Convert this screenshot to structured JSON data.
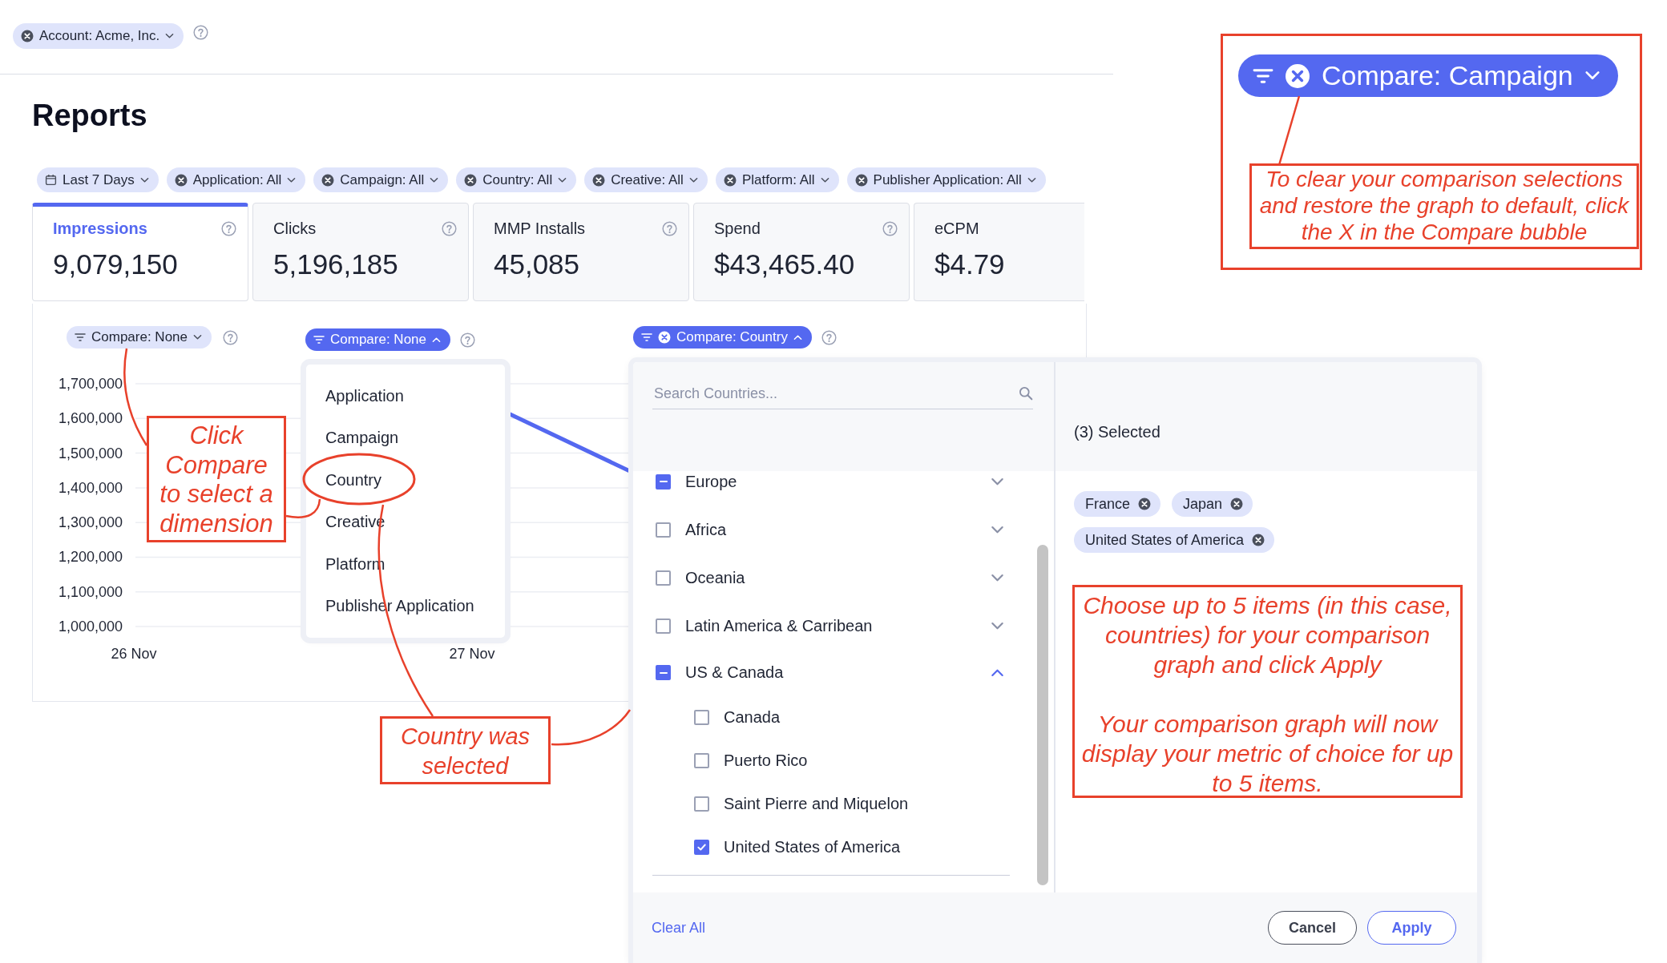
{
  "account_filter": {
    "label": "Account: Acme, Inc."
  },
  "page_title": "Reports",
  "filters": [
    {
      "label": "Last 7 Days",
      "kind": "date"
    },
    {
      "label": "Application: All",
      "kind": "clearable"
    },
    {
      "label": "Campaign: All",
      "kind": "clearable"
    },
    {
      "label": "Country: All",
      "kind": "clearable"
    },
    {
      "label": "Creative: All",
      "kind": "clearable"
    },
    {
      "label": "Platform: All",
      "kind": "clearable"
    },
    {
      "label": "Publisher Application: All",
      "kind": "clearable"
    }
  ],
  "metrics": [
    {
      "label": "Impressions",
      "value": "9,079,150",
      "selected": true,
      "help": true
    },
    {
      "label": "Clicks",
      "value": "5,196,185",
      "selected": false,
      "help": true
    },
    {
      "label": "MMP Installs",
      "value": "45,085",
      "selected": false,
      "help": true
    },
    {
      "label": "Spend",
      "value": "$43,465.40",
      "selected": false,
      "help": true
    },
    {
      "label": "eCPM",
      "value": "$4.79",
      "selected": false,
      "help": false
    }
  ],
  "chart": {
    "compare_chip": {
      "label": "Compare: None",
      "active": false,
      "clearable": false,
      "expanded": false
    },
    "y_axis_labels": [
      "1,700,000",
      "1,600,000",
      "1,500,000",
      "1,400,000",
      "1,300,000",
      "1,200,000",
      "1,100,000",
      "1,000,000"
    ],
    "x_axis_labels": [
      "26 Nov",
      "27 Nov"
    ]
  },
  "compare_menu": {
    "chip": {
      "label": "Compare: None",
      "active": true,
      "clearable": false,
      "expanded": true
    },
    "items": [
      "Application",
      "Campaign",
      "Country",
      "Creative",
      "Platform",
      "Publisher Application"
    ]
  },
  "country_picker": {
    "chip": {
      "label": "Compare: Country",
      "active": true,
      "clearable": true,
      "expanded": true
    },
    "search": {
      "placeholder": "Search Countries..."
    },
    "selected_count": "(3) Selected",
    "regions": [
      {
        "label": "Europe",
        "checked": false,
        "indeterminate": true,
        "expanded": false
      },
      {
        "label": "Africa",
        "checked": false,
        "indeterminate": false,
        "expanded": false
      },
      {
        "label": "Oceania",
        "checked": false,
        "indeterminate": false,
        "expanded": false
      },
      {
        "label": "Latin America & Carribean",
        "checked": false,
        "indeterminate": false,
        "expanded": false
      },
      {
        "label": "US & Canada",
        "checked": false,
        "indeterminate": true,
        "expanded": true,
        "children": [
          {
            "label": "Canada",
            "checked": false
          },
          {
            "label": "Puerto Rico",
            "checked": false
          },
          {
            "label": "Saint Pierre and Miquelon",
            "checked": false
          },
          {
            "label": "United States of America",
            "checked": true
          }
        ]
      }
    ],
    "selected_items": [
      "France",
      "Japan",
      "United States of America"
    ],
    "clear_all": "Clear All",
    "cancel": "Cancel",
    "apply": "Apply"
  },
  "callout": {
    "chip": {
      "label": "Compare: Campaign",
      "active": true,
      "clearable": true,
      "expanded": false
    },
    "note": "To clear your comparison selections and restore the graph to default, click the X in the Compare bubble"
  },
  "annotations": {
    "click_compare": "Click Compare to select a dimension",
    "country_selected": "Country was selected",
    "choose_items": [
      "Choose up to 5 items (in this case, countries) for your comparison graph and click Apply",
      "Your comparison graph will now display your metric of choice for up to 5 items."
    ]
  }
}
